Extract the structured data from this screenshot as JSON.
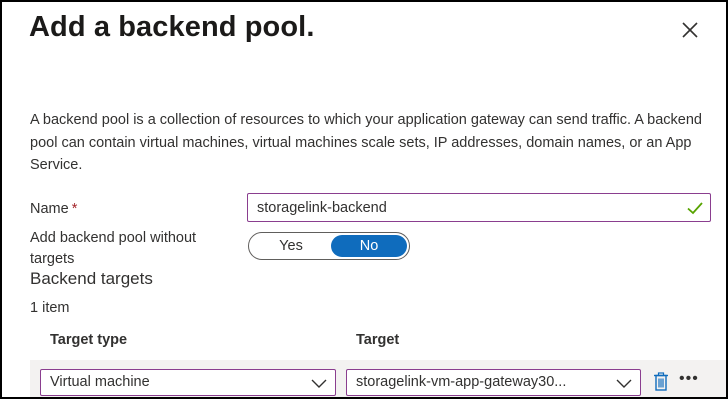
{
  "panel": {
    "title": "Add a backend pool.",
    "description": "A backend pool is a collection of resources to which your application gateway can send traffic. A backend pool can contain virtual machines, virtual machines scale sets, IP addresses, domain names, or an App Service."
  },
  "form": {
    "name_label": "Name",
    "required_mark": "*",
    "name_value": "storagelink-backend",
    "without_targets_label": "Add backend pool without targets",
    "toggle_yes": "Yes",
    "toggle_no": "No",
    "toggle_selected": "No"
  },
  "targets": {
    "heading": "Backend targets",
    "count": "1 item",
    "columns": [
      "Target type",
      "Target"
    ],
    "rows": [
      {
        "target_type": "Virtual machine",
        "target": "storagelink-vm-app-gateway30..."
      }
    ]
  },
  "colors": {
    "accent": "#0f6cbd",
    "input_border": "#8a3e8f",
    "valid_check": "#57a300",
    "required": "#a4262c"
  },
  "icons": [
    "close-icon",
    "checkmark-icon",
    "chevron-down-icon",
    "trash-icon",
    "more-icon"
  ]
}
